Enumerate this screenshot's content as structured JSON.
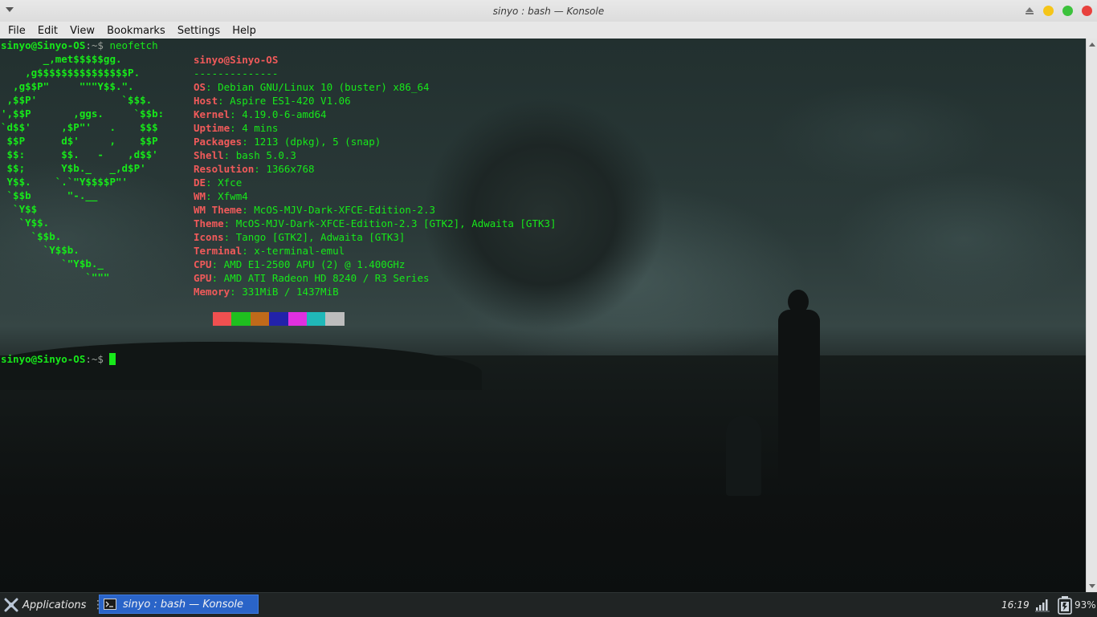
{
  "window": {
    "title": "sinyo : bash — Konsole",
    "buttons": {
      "minimize": "#f5c518",
      "maximize": "#3cc23c",
      "close": "#e8413d"
    }
  },
  "menubar": {
    "items": [
      "File",
      "Edit",
      "View",
      "Bookmarks",
      "Settings",
      "Help"
    ]
  },
  "terminal": {
    "prompt_userhost": "sinyo@Sinyo-OS",
    "prompt_path": ":~$",
    "command": " neofetch",
    "ascii_logo": "       _,met$$$$$gg.\n    ,g$$$$$$$$$$$$$$$P.\n  ,g$$P\"     \"\"\"Y$$.\".\n ,$$P'              `$$$.\n',$$P       ,ggs.     `$$b:\n`d$$'     ,$P\"'   .    $$$\n $$P      d$'     ,    $$P\n $$:      $$.   -    ,d$$'\n $$;      Y$b._   _,d$P'\n Y$$.    `.`\"Y$$$$P\"'\n `$$b      \"-.__\n  `Y$$\n   `Y$$.\n     `$$b.\n       `Y$$b.\n          `\"Y$b._\n              `\"\"\"",
    "info_title": "sinyo@Sinyo-OS",
    "info_separator": "--------------",
    "info": [
      {
        "key": "OS",
        "value": "Debian GNU/Linux 10 (buster) x86_64"
      },
      {
        "key": "Host",
        "value": "Aspire ES1-420 V1.06"
      },
      {
        "key": "Kernel",
        "value": "4.19.0-6-amd64"
      },
      {
        "key": "Uptime",
        "value": "4 mins"
      },
      {
        "key": "Packages",
        "value": "1213 (dpkg), 5 (snap)"
      },
      {
        "key": "Shell",
        "value": "bash 5.0.3"
      },
      {
        "key": "Resolution",
        "value": "1366x768"
      },
      {
        "key": "DE",
        "value": "Xfce"
      },
      {
        "key": "WM",
        "value": "Xfwm4"
      },
      {
        "key": "WM Theme",
        "value": "McOS-MJV-Dark-XFCE-Edition-2.3"
      },
      {
        "key": "Theme",
        "value": "McOS-MJV-Dark-XFCE-Edition-2.3 [GTK2], Adwaita [GTK3]"
      },
      {
        "key": "Icons",
        "value": "Tango [GTK2], Adwaita [GTK3]"
      },
      {
        "key": "Terminal",
        "value": "x-terminal-emul"
      },
      {
        "key": "CPU",
        "value": "AMD E1-2500 APU (2) @ 1.400GHz"
      },
      {
        "key": "GPU",
        "value": "AMD ATI Radeon HD 8240 / R3 Series"
      },
      {
        "key": "Memory",
        "value": "331MiB / 1437MiB"
      }
    ],
    "palette": [
      "#f05050",
      "#1fbf1f",
      "#c06a1a",
      "#2222aa",
      "#e030e0",
      "#20b8b8",
      "#bdbdbd"
    ],
    "cursor_color": "#17e81a"
  },
  "taskbar": {
    "applications_label": "Applications",
    "task_label": "sinyo : bash — Konsole",
    "clock": "16:19",
    "battery": "93%"
  }
}
